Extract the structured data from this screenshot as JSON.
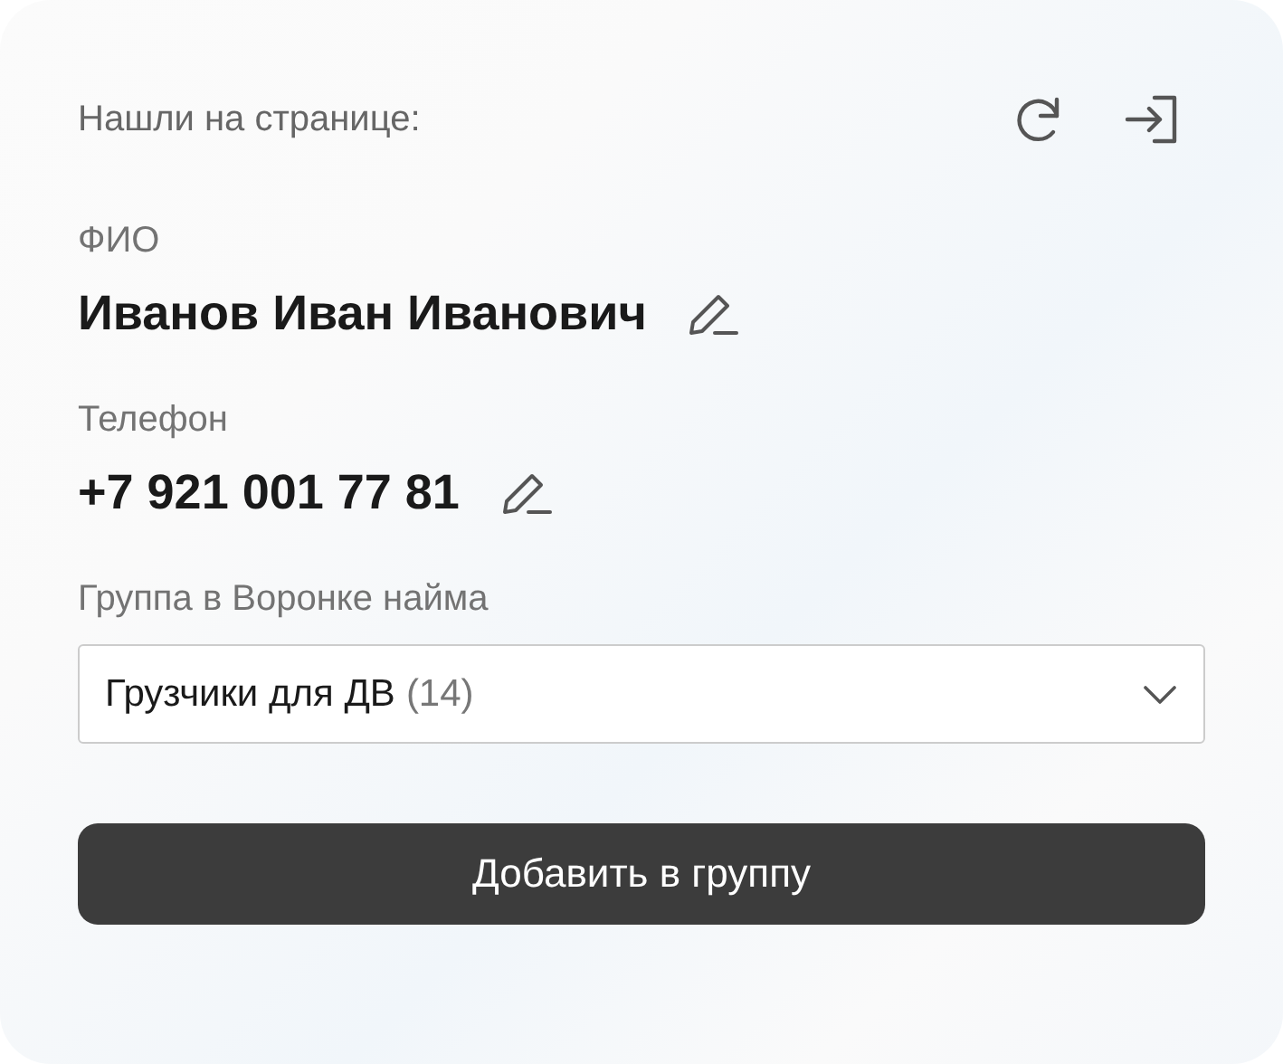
{
  "header": {
    "title": "Нашли на странице:"
  },
  "fields": [
    {
      "label": "ФИО",
      "value": "Иванов Иван Иванович",
      "kind": "name"
    },
    {
      "label": "Телефон",
      "value": "+7 921 001 77 81",
      "kind": "phone"
    }
  ],
  "group_select": {
    "label": "Группа в Воронке найма",
    "value": "Грузчики для ДВ",
    "count": "(14)"
  },
  "submit_button": {
    "label": "Добавить в группу"
  }
}
